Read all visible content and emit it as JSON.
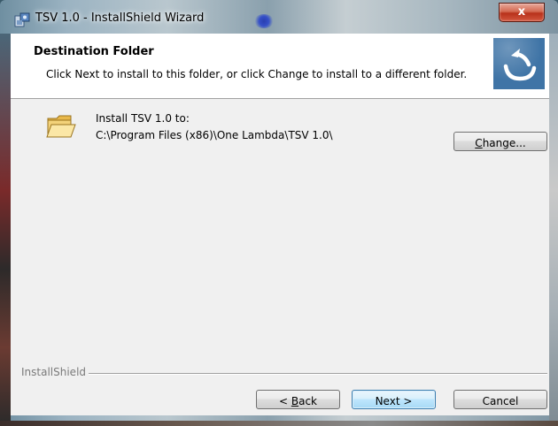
{
  "window": {
    "title": "TSV 1.0 - InstallShield Wizard",
    "close_label": "x"
  },
  "banner": {
    "title": "Destination Folder",
    "subtitle": "Click Next to install to this folder, or click Change to install to a different folder."
  },
  "content": {
    "install_label": "Install TSV 1.0 to:",
    "install_path": "C:\\Program Files (x86)\\One Lambda\\TSV 1.0\\",
    "change_button": {
      "accel": "C",
      "rest": "hange..."
    }
  },
  "footer": {
    "brand": "InstallShield",
    "back_button": {
      "prefix": "< ",
      "accel": "B",
      "rest": "ack"
    },
    "next_button": "Next >",
    "cancel_button": "Cancel"
  },
  "colors": {
    "accent": "#3f74a6",
    "close_red": "#c8442a",
    "dialog_bg": "#f0f0f0"
  },
  "icons": [
    "installer-app-icon",
    "close-icon",
    "installshield-logo-icon",
    "folder-icon"
  ]
}
